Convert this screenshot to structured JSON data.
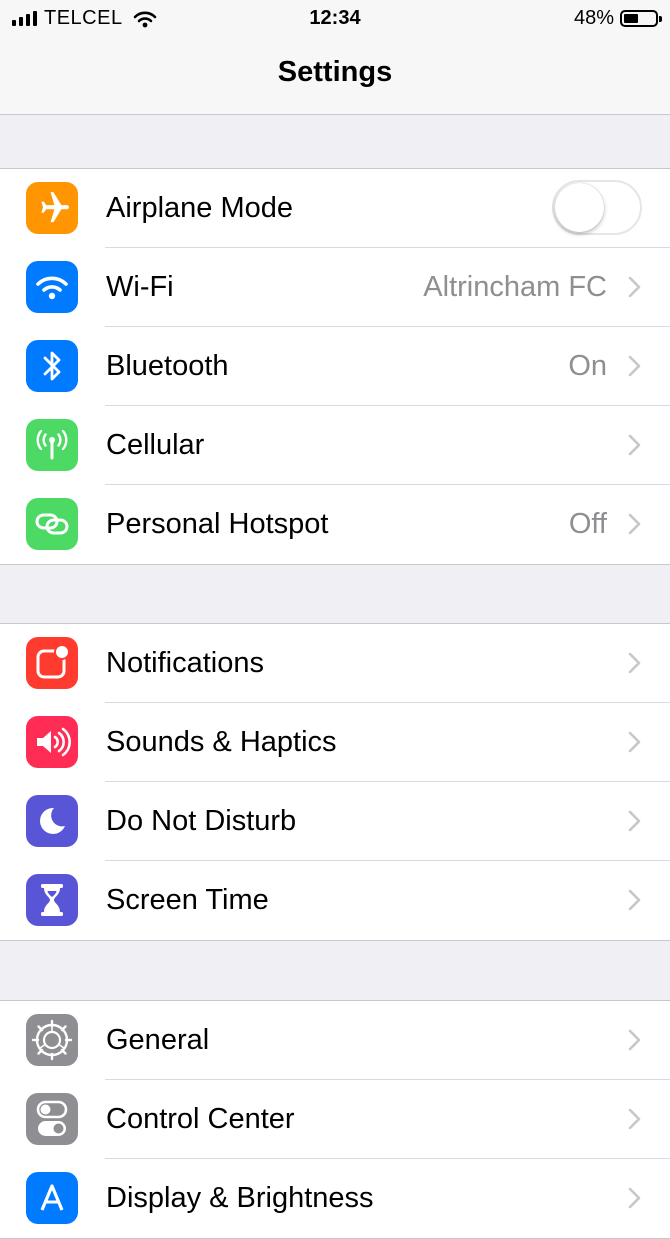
{
  "status_bar": {
    "carrier": "TELCEL",
    "time": "12:34",
    "battery_percent": "48%",
    "battery_level": 0.48
  },
  "nav": {
    "title": "Settings"
  },
  "groups": [
    {
      "rows": [
        {
          "label": "Airplane Mode",
          "icon": "airplane-icon",
          "icon_color": "#ff9500",
          "toggle_on": false
        },
        {
          "label": "Wi-Fi",
          "value": "Altrincham FC",
          "icon": "wifi-icon",
          "icon_color": "#007aff"
        },
        {
          "label": "Bluetooth",
          "value": "On",
          "icon": "bluetooth-icon",
          "icon_color": "#007aff"
        },
        {
          "label": "Cellular",
          "icon": "antenna-icon",
          "icon_color": "#4cd964"
        },
        {
          "label": "Personal Hotspot",
          "value": "Off",
          "icon": "hotspot-link-icon",
          "icon_color": "#4cd964"
        }
      ]
    },
    {
      "rows": [
        {
          "label": "Notifications",
          "icon": "notification-badge-icon",
          "icon_color": "#ff3b30"
        },
        {
          "label": "Sounds & Haptics",
          "icon": "speaker-icon",
          "icon_color": "#ff2d55"
        },
        {
          "label": "Do Not Disturb",
          "icon": "moon-icon",
          "icon_color": "#5856d6"
        },
        {
          "label": "Screen Time",
          "icon": "hourglass-icon",
          "icon_color": "#5856d6"
        }
      ]
    },
    {
      "rows": [
        {
          "label": "General",
          "icon": "gear-icon",
          "icon_color": "#8e8e93"
        },
        {
          "label": "Control Center",
          "icon": "switches-icon",
          "icon_color": "#8e8e93"
        },
        {
          "label": "Display & Brightness",
          "icon": "text-size-icon",
          "icon_color": "#007aff"
        }
      ]
    }
  ]
}
